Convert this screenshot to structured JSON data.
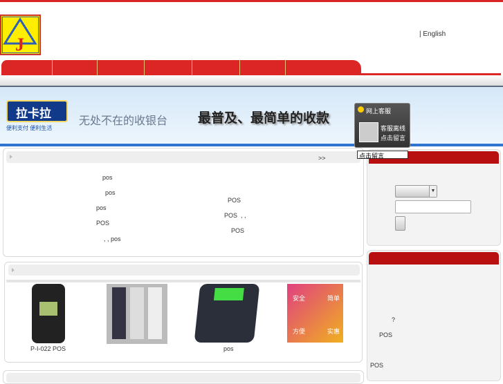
{
  "header": {
    "logo_letter": "J",
    "lang_link": "| English"
  },
  "banner": {
    "brand": "拉卡拉",
    "brand_sub": "便利支付 便利生活",
    "slogan1": "无处不在的收银台",
    "slogan2": "最普及、最简单的收款"
  },
  "chat": {
    "title": "网上客服",
    "status": "客服离线",
    "leave_msg": "点击留言",
    "tooltip": "点击留言"
  },
  "news": {
    "more": ">>",
    "left_items": [
      "pos",
      "pos",
      "pos",
      "POS",
      ", , pos"
    ],
    "right_items": [
      "POS",
      "POS  , ,",
      "POS"
    ]
  },
  "products": {
    "items": [
      {
        "caption": "P-I-022 POS"
      },
      {
        "caption": ""
      },
      {
        "caption": "pos"
      },
      {
        "caption": ""
      }
    ],
    "promo_words": [
      "安全",
      "简单",
      "方便",
      "实惠"
    ]
  },
  "side2": {
    "items": [
      "?",
      "POS",
      "POS"
    ]
  }
}
